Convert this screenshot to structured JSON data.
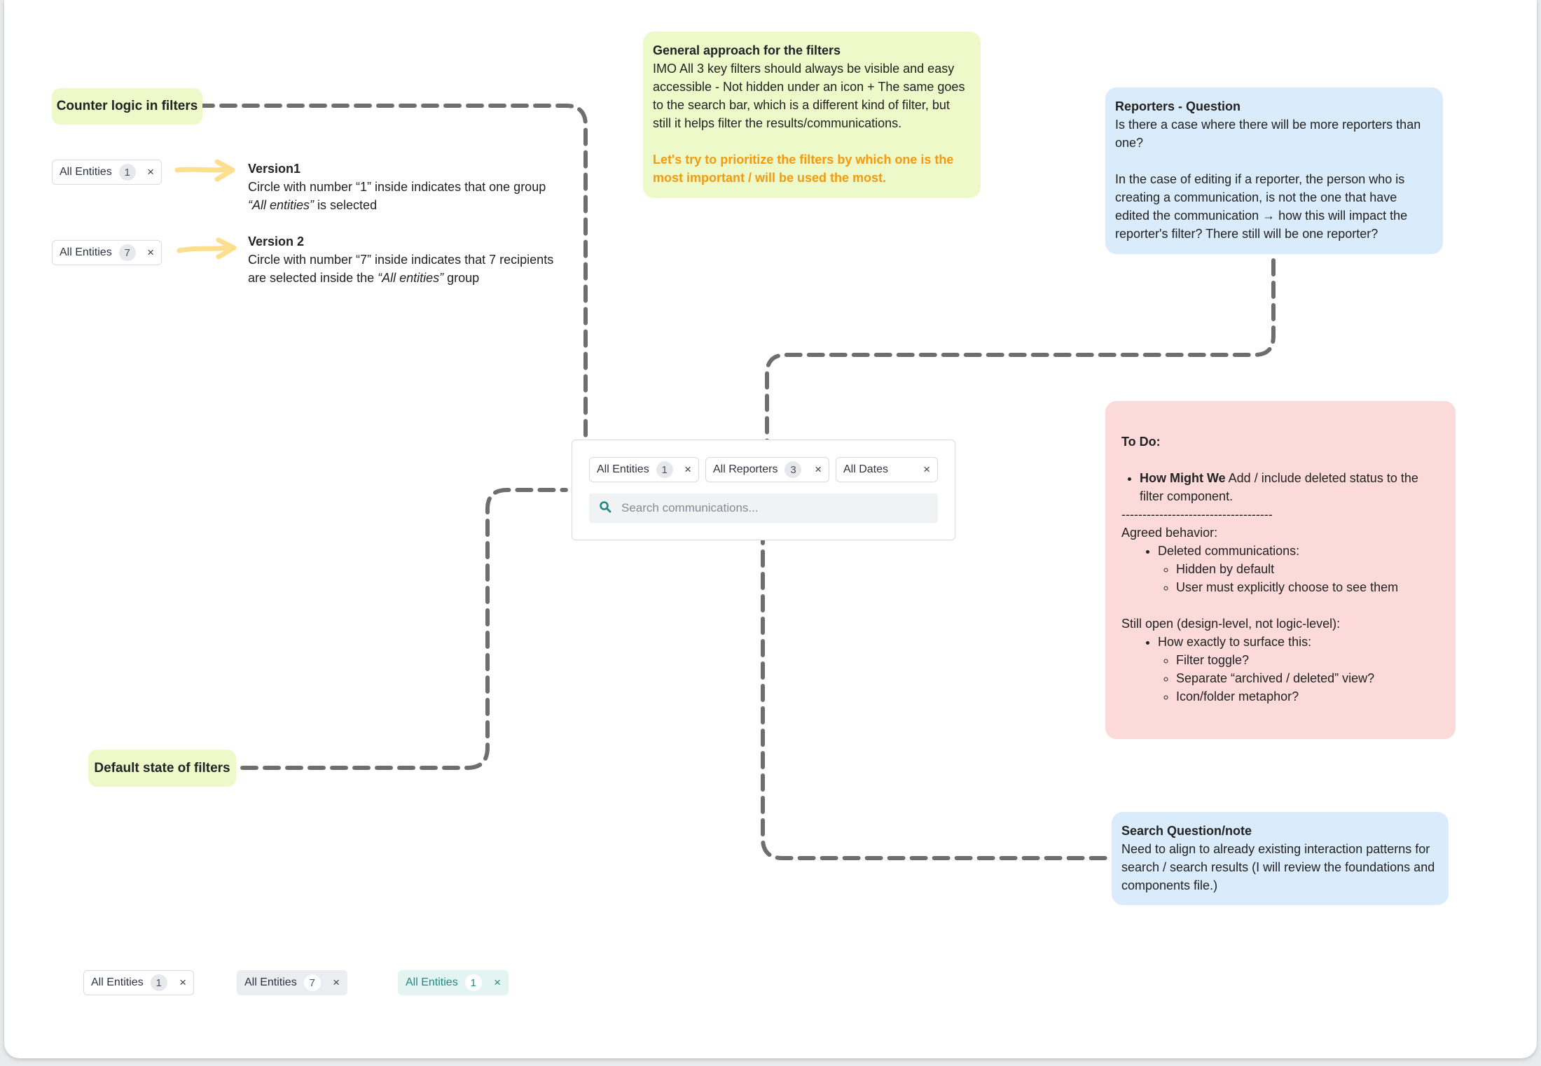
{
  "labels": {
    "counter_logic": "Counter logic in filters",
    "default_state": "Default state of filters"
  },
  "version1": {
    "title": "Version1",
    "line1": "Circle with number “1” inside indicates that one group",
    "line2_italic": "“All entities”",
    "line2_rest": " is selected"
  },
  "version2": {
    "title": "Version 2",
    "line1": "Circle with number “7” inside indicates that 7 recipients",
    "line2_pre": "are selected inside the ",
    "line2_italic": "“All entities”",
    "line2_rest": " group"
  },
  "chips": {
    "v1": {
      "label": "All Entities",
      "count": "1",
      "close": "×"
    },
    "v2": {
      "label": "All Entities",
      "count": "7",
      "close": "×"
    },
    "entities": {
      "label": "All Entities",
      "count": "1",
      "close": "×"
    },
    "reporters": {
      "label": "All Reporters",
      "count": "3",
      "close": "×"
    },
    "dates": {
      "label": "All Dates",
      "close": "×"
    },
    "state_default": {
      "label": "All Entities",
      "count": "1",
      "close": "×"
    },
    "state_hover": {
      "label": "All Entities",
      "count": "7",
      "close": "×"
    },
    "state_active": {
      "label": "All Entities",
      "count": "1",
      "close": "×"
    }
  },
  "search": {
    "placeholder": "Search communications...",
    "icon": "search-icon"
  },
  "general_note": {
    "title": "General approach for the filters",
    "body": "IMO All 3 key filters should always be visible and easy accessible - Not hidden under an icon + The same goes to the search bar, which is a different kind of filter, but still it helps filter the results/communications.",
    "highlight": "Let's try to prioritize the filters by which one is the most important / will be used the most."
  },
  "reporters_note": {
    "title": "Reporters - Question",
    "p1": "Is there a case where there will be more reporters than one?",
    "p2": "In the case of editing if a reporter, the person who is creating a communication, is not the one that have edited the communication → how this will impact the reporter's filter? There still will be one reporter?"
  },
  "todo_note": {
    "title": "To Do:",
    "hmw_bold": "How Might We",
    "hmw_rest": " Add / include deleted status to the filter component.",
    "divider": "------------------------------------",
    "agreed": "Agreed behavior:",
    "deleted": "Deleted communications:",
    "deleted_items": [
      "Hidden by default",
      "User must explicitly choose to see them"
    ],
    "open": "Still open (design-level, not logic-level):",
    "surface": "How exactly to surface this:",
    "surface_items": [
      "Filter toggle?",
      "Separate “archived / deleted” view?",
      "Icon/folder metaphor?"
    ]
  },
  "search_note": {
    "title": "Search Question/note",
    "body": "Need to align to already existing interaction patterns for search / search results  (I will review the foundations and components file.)"
  },
  "colors": {
    "green_note": "#eef9c9",
    "blue_note": "#daebfb",
    "red_note": "#fcdada",
    "highlight_orange": "#f39a0f",
    "connector": "#6e6e6e",
    "arrow": "#fbdf8f",
    "teal": "#1f8a84"
  }
}
